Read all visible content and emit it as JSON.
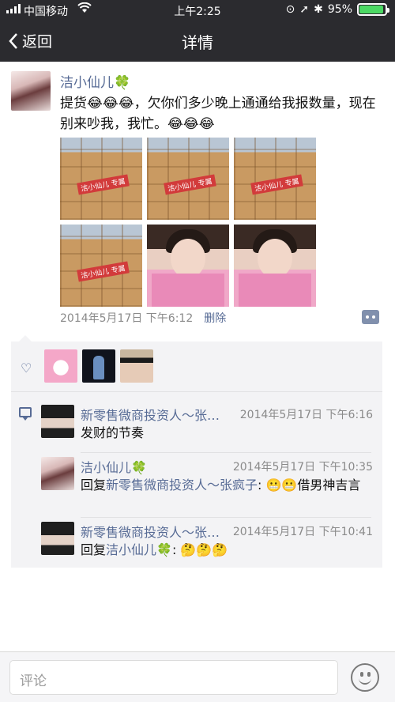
{
  "status": {
    "carrier": "中国移动",
    "time": "上午2:25",
    "battery": "95%",
    "battery_level": 0.95
  },
  "nav": {
    "back_label": "返回",
    "title": "详情"
  },
  "post": {
    "author": "洁小仙儿",
    "author_emoji": "🍀",
    "text": "提货😂😂😂，欠你们多少晚上通通给我报数量，现在别来吵我，我忙。😂😂😂",
    "photo_watermark": "洁小仙儿 专属",
    "timestamp": "2014年5月17日 下午6:12",
    "delete_label": "删除"
  },
  "comments": [
    {
      "name": "新零售微商投资人～张…",
      "time": "2014年5月17日 下午6:16",
      "text": "发财的节奏"
    },
    {
      "name": "洁小仙儿",
      "name_emoji": "🍀",
      "time": "2014年5月17日 下午10:35",
      "reply_prefix": "回复",
      "reply_to": "新零售微商投资人～张疯子",
      "text": ": 😬😬借男神吉言"
    },
    {
      "name": "新零售微商投资人～张…",
      "time": "2014年5月17日 下午10:41",
      "reply_prefix": "回复",
      "reply_to": "洁小仙儿",
      "reply_to_emoji": "🍀",
      "text": ": 🤔🤔🤔"
    }
  ],
  "input": {
    "placeholder": "评论"
  }
}
